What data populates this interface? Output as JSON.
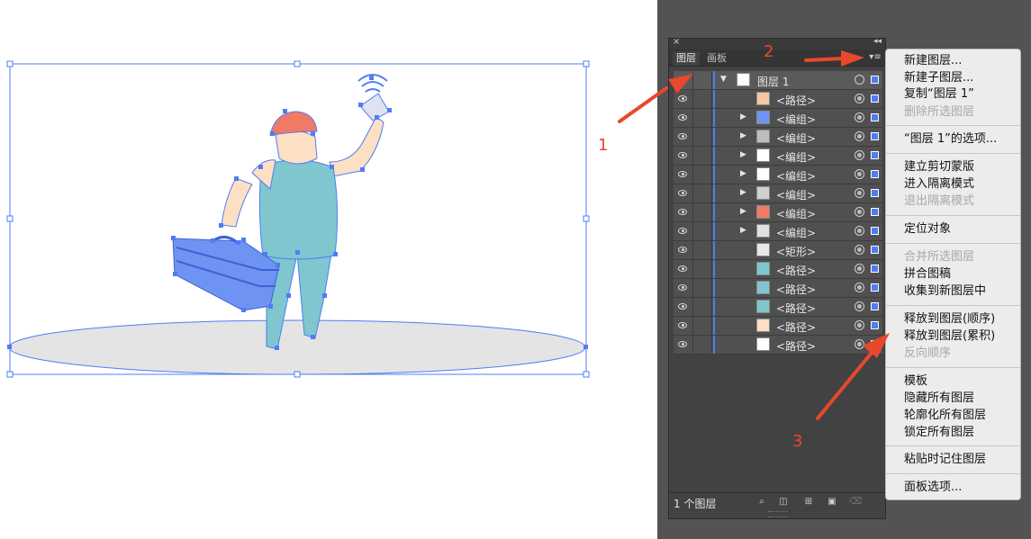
{
  "panel": {
    "close_glyph": "×",
    "collapse_glyph": "◂◂",
    "tabs": [
      {
        "label": "图层"
      },
      {
        "label": "画板"
      }
    ],
    "menu_glyph": "▾≡",
    "parent_layer": {
      "label": "图层 1"
    },
    "rows": [
      {
        "label": "<路径>",
        "expand": ""
      },
      {
        "label": "<编组>",
        "expand": "▶"
      },
      {
        "label": "<编组>",
        "expand": "▶"
      },
      {
        "label": "<编组>",
        "expand": "▶"
      },
      {
        "label": "<编组>",
        "expand": "▶"
      },
      {
        "label": "<编组>",
        "expand": "▶"
      },
      {
        "label": "<编组>",
        "expand": "▶"
      },
      {
        "label": "<编组>",
        "expand": "▶"
      },
      {
        "label": "<矩形>",
        "expand": ""
      },
      {
        "label": "<路径>",
        "expand": ""
      },
      {
        "label": "<路径>",
        "expand": ""
      },
      {
        "label": "<路径>",
        "expand": ""
      },
      {
        "label": "<路径>",
        "expand": ""
      },
      {
        "label": "<路径>",
        "expand": ""
      }
    ],
    "footer": {
      "count": "1 个图层"
    }
  },
  "menu": {
    "items": [
      {
        "label": "新建图层...",
        "disabled": false
      },
      {
        "label": "新建子图层...",
        "disabled": false
      },
      {
        "label": "复制“图层 1”",
        "disabled": false
      },
      {
        "label": "删除所选图层",
        "disabled": true
      },
      {
        "label": "“图层 1”的选项...",
        "disabled": false
      },
      {
        "label": "建立剪切蒙版",
        "disabled": false
      },
      {
        "label": "进入隔离模式",
        "disabled": false
      },
      {
        "label": "退出隔离模式",
        "disabled": true
      },
      {
        "label": "定位对象",
        "disabled": false
      },
      {
        "label": "合并所选图层",
        "disabled": true
      },
      {
        "label": "拼合图稿",
        "disabled": false
      },
      {
        "label": "收集到新图层中",
        "disabled": false
      },
      {
        "label": "释放到图层(顺序)",
        "disabled": false
      },
      {
        "label": "释放到图层(累积)",
        "disabled": false
      },
      {
        "label": "反向顺序",
        "disabled": true
      },
      {
        "label": "模板",
        "disabled": false
      },
      {
        "label": "隐藏所有图层",
        "disabled": false
      },
      {
        "label": "轮廓化所有图层",
        "disabled": false
      },
      {
        "label": "锁定所有图层",
        "disabled": false
      },
      {
        "label": "粘贴时记住图层",
        "disabled": false
      },
      {
        "label": "面板选项...",
        "disabled": false
      }
    ]
  },
  "annotations": {
    "one": "1",
    "two": "2",
    "three": "3"
  },
  "colors": {
    "selection": "#4f7cf6",
    "annotation": "#e8482c",
    "panel_bg": "#424242",
    "menu_bg": "#ececec"
  }
}
